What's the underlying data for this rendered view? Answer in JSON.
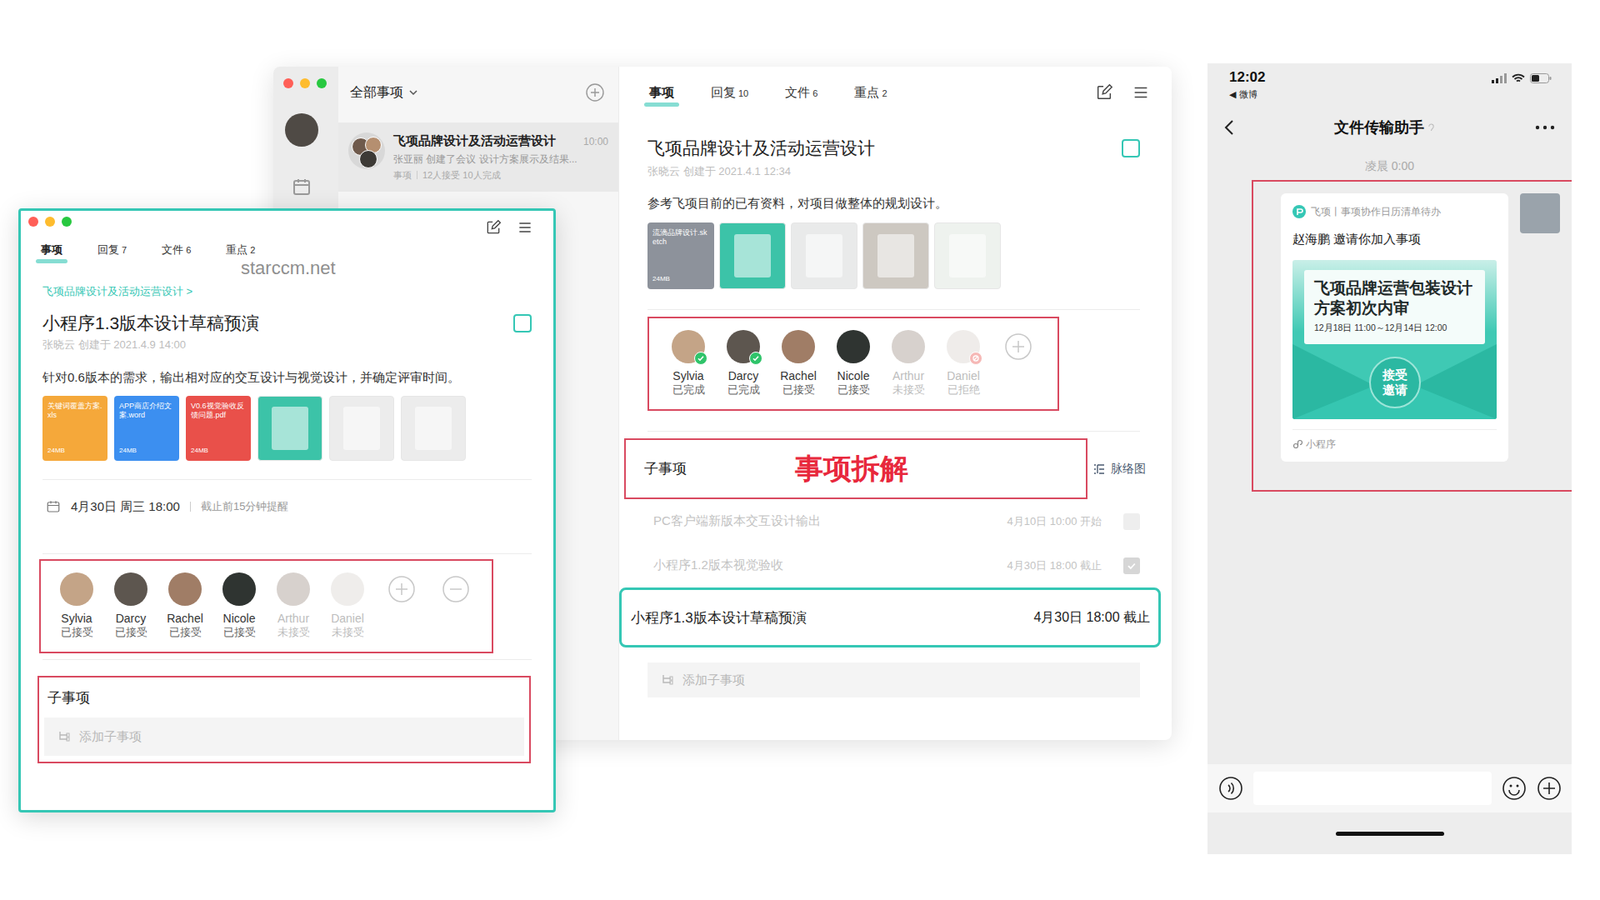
{
  "watermark": "starccm.net",
  "back_window": {
    "list_header": "全部事项",
    "list_items": [
      {
        "title": "飞项品牌设计及活动运营设计",
        "time": "10:00",
        "preview": "张亚丽 创建了会议 设计方案展示及结果...",
        "meta_type": "事项",
        "meta": "12人接受 10人完成",
        "selected": true
      }
    ],
    "tabs": [
      {
        "label": "事项",
        "selected": true
      },
      {
        "label": "回复",
        "count": "10",
        "selected": false
      },
      {
        "label": "文件",
        "count": "6",
        "selected": false
      },
      {
        "label": "重点",
        "count": "2",
        "selected": false
      }
    ],
    "title": "飞项品牌设计及活动运营设计",
    "completed": false,
    "creator": "张晓云 创建于 2021.4.1 12:34",
    "description": "参考飞项目前的已有资料，对项目做整体的规划设计。",
    "attachments": [
      {
        "kind": "file",
        "name": "流滴品牌设计",
        "ext": ".sketch",
        "size": "24MB",
        "color": "#8d929b"
      },
      {
        "kind": "image",
        "color": "#3cc3a8"
      },
      {
        "kind": "image",
        "color": "#e9eaea"
      },
      {
        "kind": "image",
        "color": "#cdc8c1"
      },
      {
        "kind": "image",
        "color": "#eef2ee"
      }
    ],
    "members": [
      {
        "name": "Sylvia",
        "status": "已完成",
        "kind": "done"
      },
      {
        "name": "Darcy",
        "status": "已完成",
        "kind": "done"
      },
      {
        "name": "Rachel",
        "status": "已接受",
        "kind": "accepted"
      },
      {
        "name": "Nicole",
        "status": "已接受",
        "kind": "accepted"
      },
      {
        "name": "Arthur",
        "status": "未接受",
        "kind": "pending"
      },
      {
        "name": "Daniel",
        "status": "已拒绝",
        "kind": "declined"
      }
    ],
    "subtasks_title": "子事项",
    "annotation": "事项拆解",
    "mindmap": "脉络图",
    "subtasks": [
      {
        "title": "PC客户端新版本交互设计输出",
        "time": "4月10日 10:00 开始",
        "checked": false,
        "greyed": true,
        "selected": false
      },
      {
        "title": "小程序1.2版本视觉验收",
        "time": "4月30日 18:00 截止",
        "checked": true,
        "greyed": true,
        "selected": false
      },
      {
        "title": "小程序1.3版本设计草稿预演",
        "time": "4月30日 18:00 截止",
        "checked": false,
        "greyed": false,
        "selected": true
      }
    ],
    "add_subtask": "添加子事项"
  },
  "front_window": {
    "tabs": [
      {
        "label": "事项",
        "selected": true
      },
      {
        "label": "回复",
        "count": "7",
        "selected": false
      },
      {
        "label": "文件",
        "count": "6",
        "selected": false
      },
      {
        "label": "重点",
        "count": "2",
        "selected": false
      }
    ],
    "breadcrumb": "飞项品牌设计及活动运营设计 >",
    "title": "小程序1.3版本设计草稿预演",
    "completed": false,
    "creator": "张晓云 创建于 2021.4.9 14:00",
    "description": "针对0.6版本的需求，输出相对应的交互设计与视觉设计，并确定评审时间。",
    "attachments": [
      {
        "kind": "file",
        "name": "关键词覆盖方案",
        "ext": ".xls",
        "size": "24MB",
        "color": "#f5a83a"
      },
      {
        "kind": "file",
        "name": "APP商店介绍文案",
        "ext": ".word",
        "size": "24MB",
        "color": "#3c8ff0"
      },
      {
        "kind": "file",
        "name": "V0.6视觉验收反馈问题",
        "ext": ".pdf",
        "size": "24MB",
        "color": "#e9504a"
      },
      {
        "kind": "image",
        "color": "#3cc3a8"
      },
      {
        "kind": "image",
        "color": "#ececec"
      },
      {
        "kind": "image",
        "color": "#ececec"
      }
    ],
    "due": "4月30日 周三 18:00",
    "reminder": "截止前15分钟提醒",
    "members": [
      {
        "name": "Sylvia",
        "status": "已接受",
        "kind": "accepted"
      },
      {
        "name": "Darcy",
        "status": "已接受",
        "kind": "accepted"
      },
      {
        "name": "Rachel",
        "status": "已接受",
        "kind": "accepted"
      },
      {
        "name": "Nicole",
        "status": "已接受",
        "kind": "accepted"
      },
      {
        "name": "Arthur",
        "status": "未接受",
        "kind": "pending"
      },
      {
        "name": "Daniel",
        "status": "未接受",
        "kind": "pending"
      }
    ],
    "subtasks_title": "子事项",
    "add_subtask": "添加子事项"
  },
  "phone": {
    "clock": "12:02",
    "back_glyph": "◀",
    "back_app": "微博",
    "title": "文件传输助手",
    "timestamp": "凌晨 0:00",
    "card": {
      "app": "飞项丨事项协作日历清单待办",
      "message": "赵海鹏 邀请你加入事项",
      "invite_title": "飞项品牌运营包装设计方案初次内审",
      "invite_range": "12月18日 11:00～12月14日 12:00",
      "accept": "接受邀请",
      "footer": "小程序"
    }
  }
}
